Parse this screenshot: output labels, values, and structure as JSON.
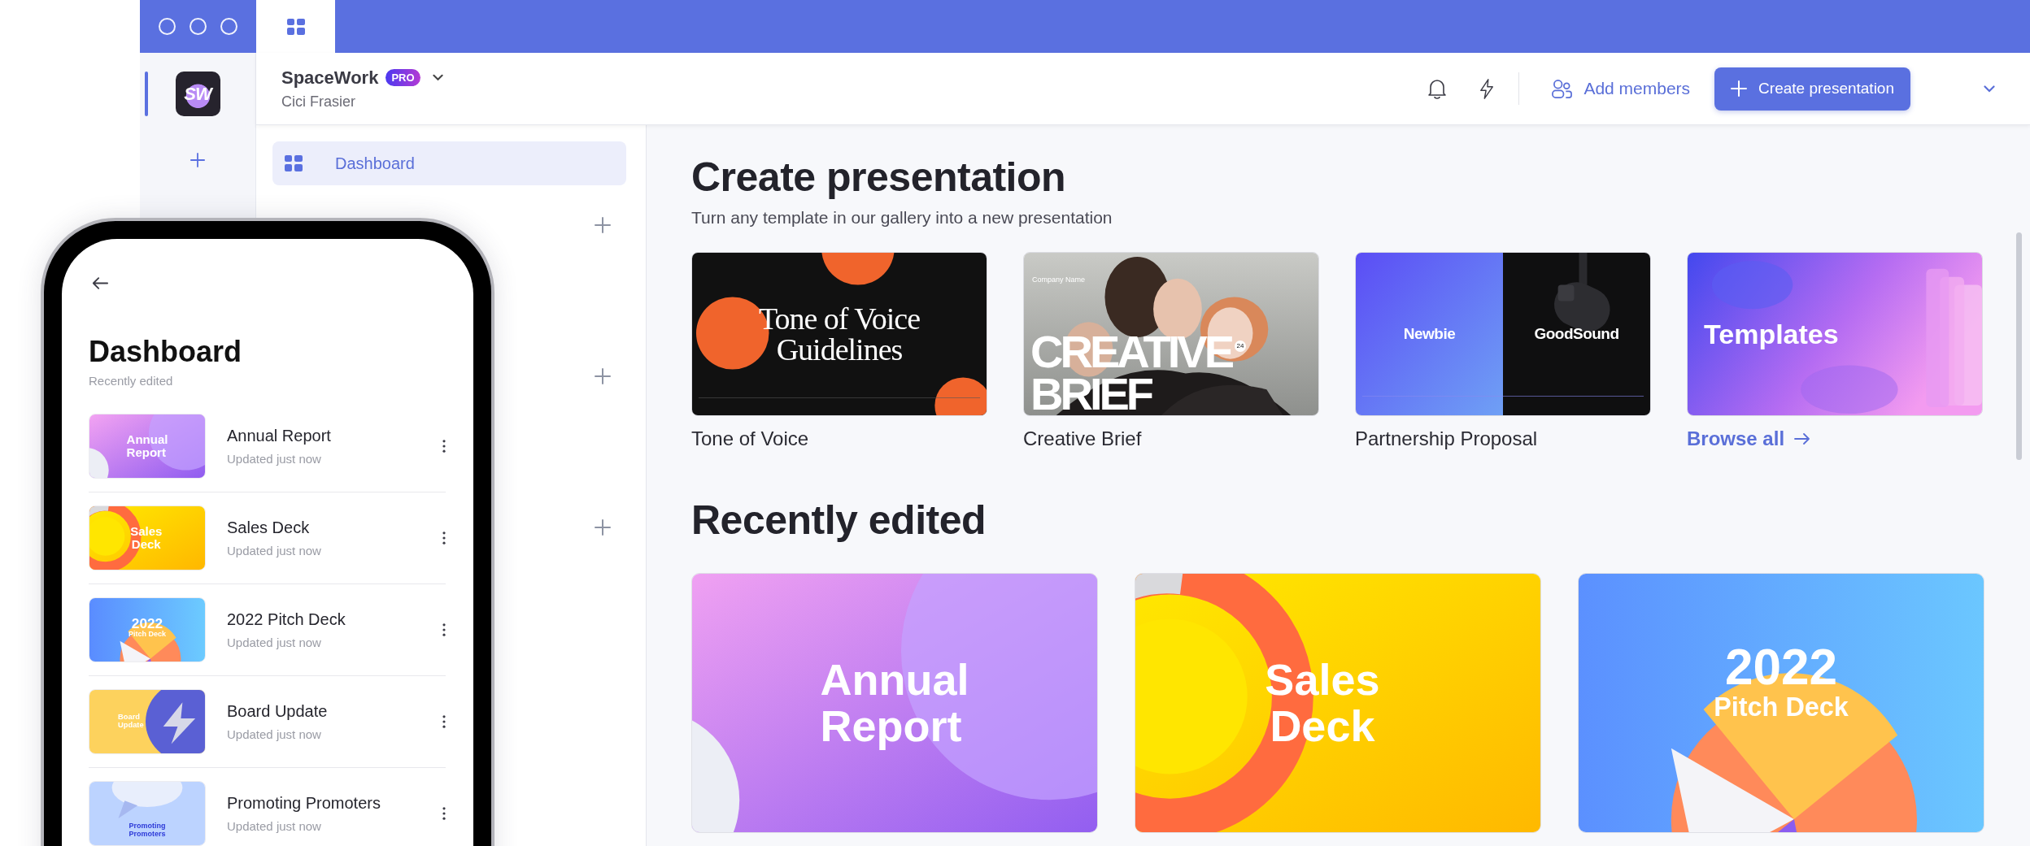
{
  "workspace": {
    "logo": "SW",
    "name": "SpaceWork",
    "badge": "PRO",
    "user": "Cici Frasier"
  },
  "header": {
    "add_members": "Add members",
    "create_button": "Create presentation"
  },
  "sidebar": {
    "items": [
      {
        "label": "Dashboard",
        "selected": true
      }
    ]
  },
  "templates": {
    "title": "Create presentation",
    "subtitle": "Turn any template in our gallery into a new presentation",
    "items": [
      {
        "kind": "tone",
        "name": "Tone of Voice",
        "slide_lines": [
          "Tone of Voice",
          "Guidelines"
        ]
      },
      {
        "kind": "creative",
        "name": "Creative Brief",
        "slide_lines": [
          "CREATIVE",
          "BRIEF"
        ],
        "slide_caption": "Company Name",
        "slide_badge": "24"
      },
      {
        "kind": "partnership",
        "name": "Partnership Proposal",
        "slide_lines": [
          "Newbie",
          "GoodSound"
        ]
      },
      {
        "kind": "gallery",
        "link": "Browse all",
        "slide_lines": [
          "Templates"
        ]
      }
    ]
  },
  "recent": {
    "title": "Recently edited",
    "items": [
      {
        "kind": "annual",
        "lines": [
          "Annual",
          "Report"
        ]
      },
      {
        "kind": "sales",
        "lines": [
          "Sales",
          "Deck"
        ]
      },
      {
        "kind": "pitch",
        "lines": [
          "2022",
          "Pitch Deck"
        ]
      }
    ]
  },
  "phone": {
    "title": "Dashboard",
    "subtitle": "Recently edited",
    "items": [
      {
        "kind": "annual",
        "title": "Annual Report",
        "updated": "Updated just now",
        "thumb_lines": [
          "Annual",
          "Report"
        ]
      },
      {
        "kind": "sales",
        "title": "Sales Deck",
        "updated": "Updated just now",
        "thumb_lines": [
          "Sales",
          "Deck"
        ]
      },
      {
        "kind": "pitch",
        "title": "2022 Pitch Deck",
        "updated": "Updated just now",
        "thumb_lines": [
          "2022",
          "Pitch Deck"
        ]
      },
      {
        "kind": "board",
        "title": "Board Update",
        "updated": "Updated just now",
        "thumb_lines": [
          "Board",
          "Update"
        ]
      },
      {
        "kind": "promoting",
        "title": "Promoting Promoters",
        "updated": "Updated just now",
        "thumb_lines": [
          "Promoting",
          "Promoters"
        ]
      }
    ]
  }
}
